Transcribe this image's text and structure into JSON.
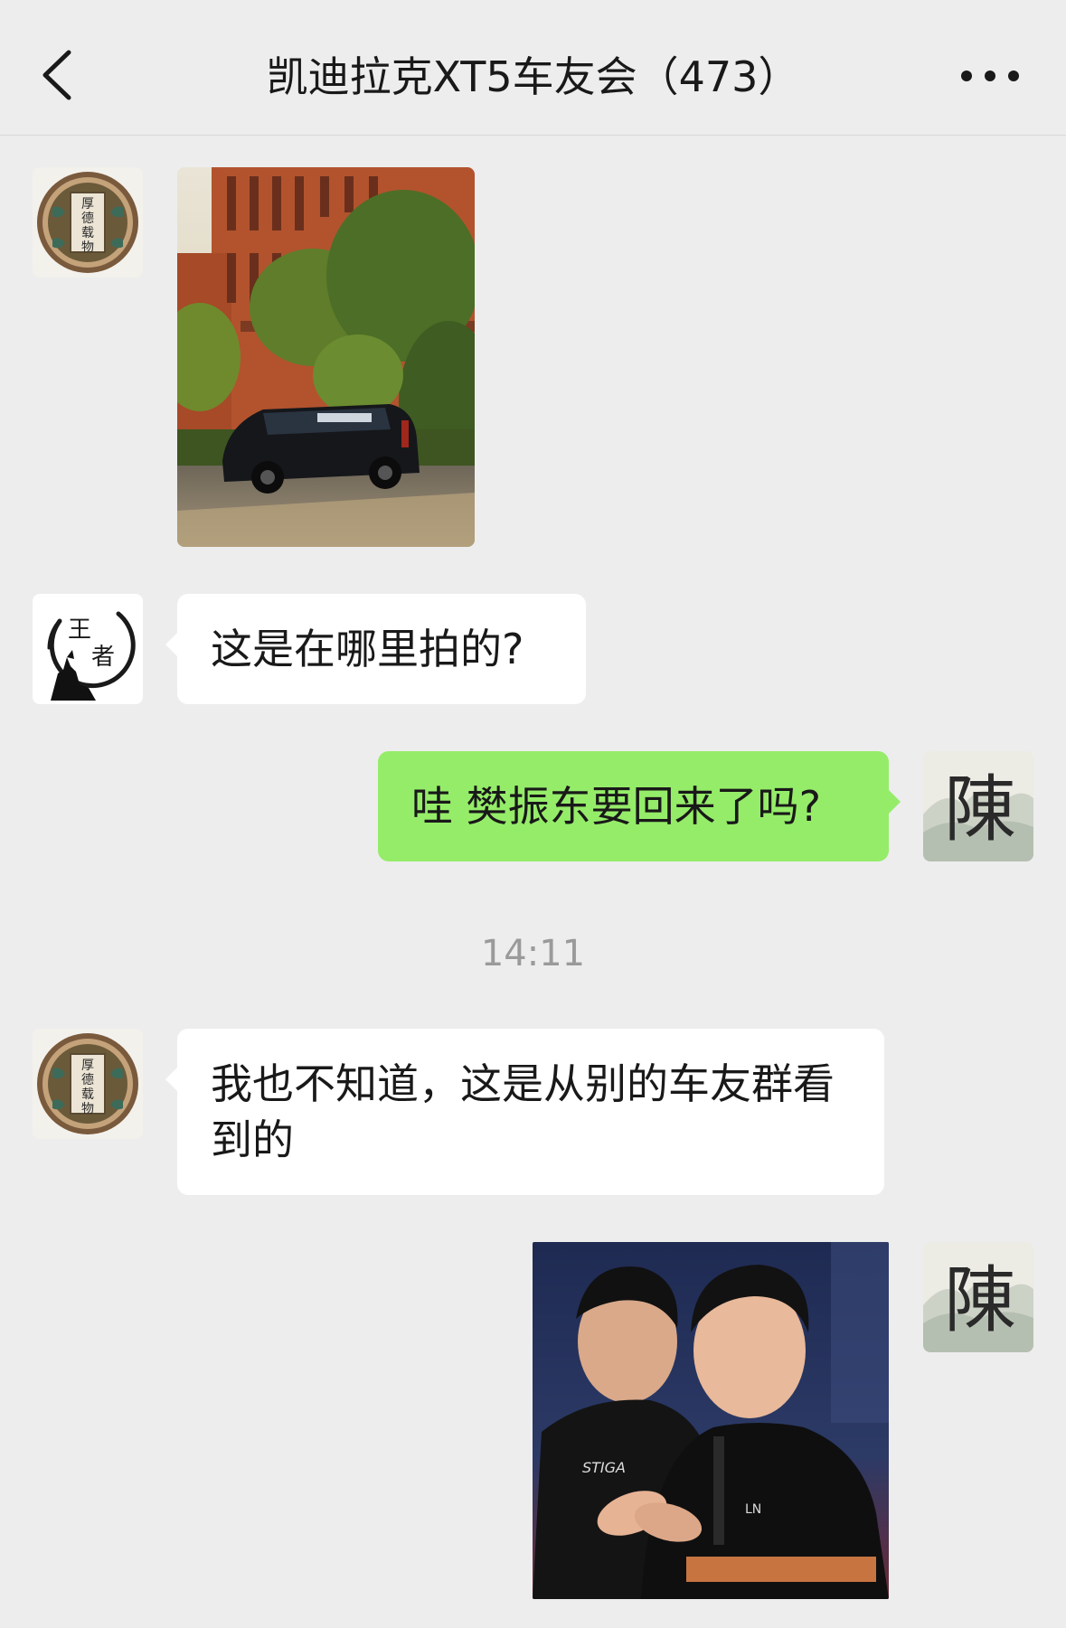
{
  "header": {
    "title": "凯迪拉克XT5车友会（473）",
    "back_icon": "chevron-left-icon",
    "more_icon": "more-dots-icon"
  },
  "avatars": {
    "a": {
      "text": "厚德载物"
    },
    "b": {
      "text": "王者"
    },
    "self": {
      "text": "陳"
    }
  },
  "messages": [
    {
      "sender": "a",
      "type": "image",
      "image": "car-photo"
    },
    {
      "sender": "b",
      "type": "text",
      "text": "这是在哪里拍的?"
    },
    {
      "sender": "self",
      "type": "text",
      "text": "哇 樊振东要回来了吗?"
    },
    {
      "type": "timestamp",
      "text": "14:11"
    },
    {
      "sender": "a",
      "type": "text",
      "text": "我也不知道，这是从别的车友群看到的"
    },
    {
      "sender": "self",
      "type": "image",
      "image": "athletes-photo"
    }
  ],
  "colors": {
    "background": "#ededed",
    "incoming_bubble": "#ffffff",
    "outgoing_bubble": "#95ec69",
    "timestamp_text": "#9a9a9a"
  }
}
